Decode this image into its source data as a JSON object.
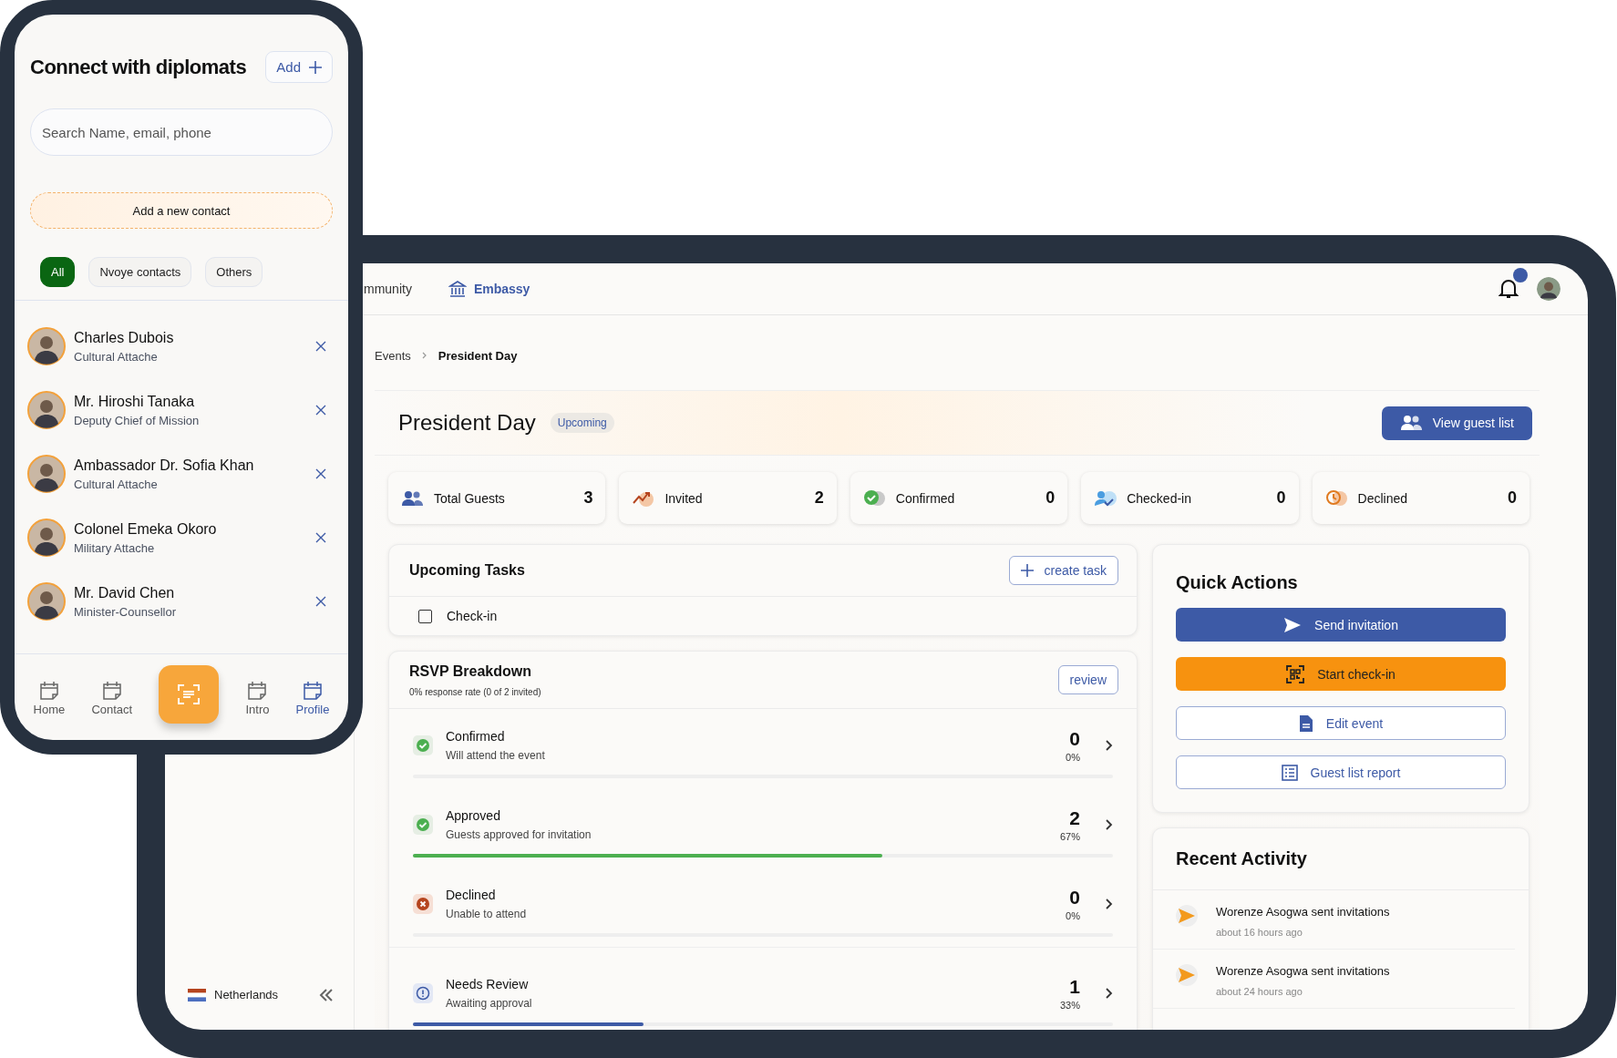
{
  "phone": {
    "title": "Connect with diplomats",
    "add_button": "Add",
    "search": {
      "placeholder": "Search Name, email, phone"
    },
    "new_contact_button": "Add a new contact",
    "filters": [
      {
        "label": "All",
        "selected": true
      },
      {
        "label": "Nvoye contacts",
        "selected": false
      },
      {
        "label": "Others",
        "selected": false
      }
    ],
    "contacts": [
      {
        "name": "Charles Dubois",
        "role": "Cultural Attache"
      },
      {
        "name": "Mr. Hiroshi Tanaka",
        "role": "Deputy Chief of Mission"
      },
      {
        "name": "Ambassador Dr. Sofia Khan",
        "role": "Cultural Attache"
      },
      {
        "name": "Colonel Emeka Okoro",
        "role": "Military Attache"
      },
      {
        "name": "Mr. David Chen",
        "role": "Minister-Counsellor"
      }
    ],
    "nav": [
      {
        "kind": "tab",
        "label": "Home",
        "selected": false
      },
      {
        "kind": "tab",
        "label": "Contact",
        "selected": false
      },
      {
        "kind": "scan",
        "selected": false
      },
      {
        "kind": "tab",
        "label": "Intro",
        "selected": false
      },
      {
        "kind": "tab",
        "label": "Profile",
        "selected": true
      }
    ]
  },
  "tablet": {
    "nav": [
      {
        "kind": "community",
        "label": "mmunity",
        "selected": false
      },
      {
        "kind": "embassy",
        "label": "Embassy",
        "selected": true
      }
    ],
    "notifications": {
      "unread": true
    },
    "breadcrumb": [
      "Events",
      "President Day"
    ],
    "event": {
      "title": "President Day",
      "status": "Upcoming",
      "button": "View guest list"
    },
    "stats": [
      {
        "kind": "total",
        "label": "Total Guests",
        "value": "3"
      },
      {
        "kind": "invited",
        "label": "Invited",
        "value": "2"
      },
      {
        "kind": "confirmed",
        "label": "Confirmed",
        "value": "0"
      },
      {
        "kind": "checked_in",
        "label": "Checked-in",
        "value": "0"
      },
      {
        "kind": "declined",
        "label": "Declined",
        "value": "0"
      }
    ],
    "tasks": {
      "title": "Upcoming Tasks",
      "button": "create task",
      "items": [
        {
          "label": "Check-in",
          "checked": false
        }
      ]
    },
    "rsvp": {
      "title": "RSVP Breakdown",
      "subtitle": "0% response rate (0 of 2 invited)",
      "button": "review",
      "rows": [
        {
          "kind": "confirmed",
          "label": "Confirmed",
          "description": "Will attend the event",
          "count": "0",
          "percent": "0%",
          "level": 0
        },
        {
          "kind": "approved",
          "label": "Approved",
          "description": "Guests approved for invitation",
          "count": "2",
          "percent": "67%",
          "level": 0.67
        },
        {
          "kind": "declined",
          "label": "Declined",
          "description": "Unable to attend",
          "count": "0",
          "percent": "0%",
          "level": 0
        },
        {
          "kind": "review",
          "label": "Needs Review",
          "description": "Awaiting approval",
          "count": "1",
          "percent": "33%",
          "level": 0.33
        }
      ]
    },
    "quick_actions": {
      "title": "Quick Actions",
      "buttons": [
        {
          "kind": "send",
          "label": "Send invitation"
        },
        {
          "kind": "checkin",
          "label": "Start check-in"
        },
        {
          "kind": "edit",
          "label": "Edit event"
        },
        {
          "kind": "report",
          "label": "Guest list report"
        }
      ]
    },
    "activity": {
      "title": "Recent Activity",
      "items": [
        {
          "text": "Worenze Asogwa sent invitations",
          "time": "about 16 hours ago"
        },
        {
          "text": "Worenze Asogwa sent invitations",
          "time": "about 24 hours ago"
        }
      ]
    },
    "sidebar": {
      "country": "Netherlands"
    }
  }
}
